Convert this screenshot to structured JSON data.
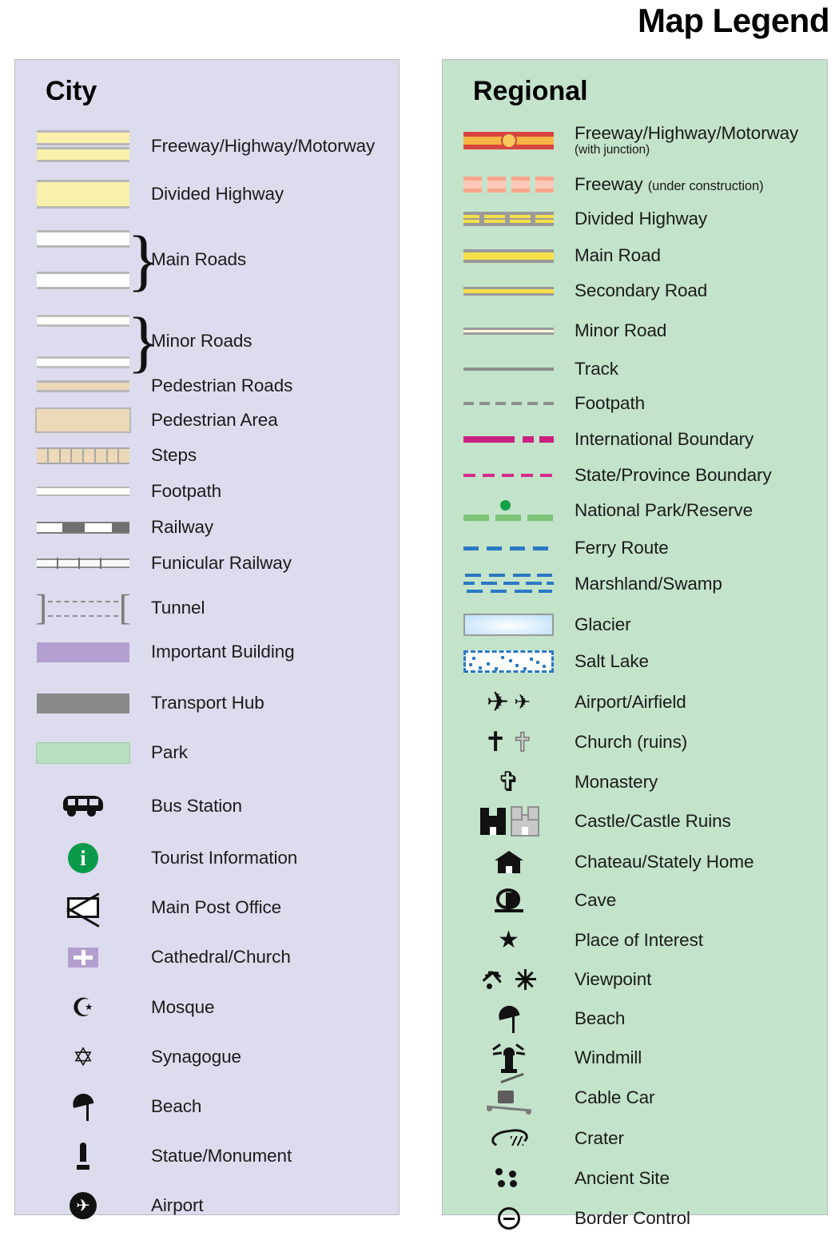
{
  "title": "Map Legend",
  "panels": {
    "city": {
      "heading": "City",
      "items": [
        {
          "label": "Freeway/Highway/Motorway",
          "symbol": "freeway-double-band"
        },
        {
          "label": "Divided Highway",
          "symbol": "divided-highway-band"
        },
        {
          "label": "Main Roads",
          "symbol": "main-roads-brace"
        },
        {
          "label": "Minor Roads",
          "symbol": "minor-roads-brace"
        },
        {
          "label": "Pedestrian Roads",
          "symbol": "pedestrian-road-band"
        },
        {
          "label": "Pedestrian Area",
          "symbol": "pedestrian-area-block"
        },
        {
          "label": "Steps",
          "symbol": "steps-band"
        },
        {
          "label": "Footpath",
          "symbol": "footpath-line"
        },
        {
          "label": "Railway",
          "symbol": "railway-dashed-line"
        },
        {
          "label": "Funicular Railway",
          "symbol": "funicular-tick-line"
        },
        {
          "label": "Tunnel",
          "symbol": "tunnel-bracket"
        },
        {
          "label": "Important Building",
          "symbol": "important-building-swatch"
        },
        {
          "label": "Transport Hub",
          "symbol": "transport-hub-swatch"
        },
        {
          "label": "Park",
          "symbol": "park-swatch"
        },
        {
          "label": "Bus Station",
          "symbol": "bus-icon"
        },
        {
          "label": "Tourist Information",
          "symbol": "information-icon"
        },
        {
          "label": "Main Post Office",
          "symbol": "envelope-icon"
        },
        {
          "label": "Cathedral/Church",
          "symbol": "cathedral-icon"
        },
        {
          "label": "Mosque",
          "symbol": "star-and-crescent-icon"
        },
        {
          "label": "Synagogue",
          "symbol": "star-of-david-icon"
        },
        {
          "label": "Beach",
          "symbol": "beach-umbrella-icon"
        },
        {
          "label": "Statue/Monument",
          "symbol": "statue-icon"
        },
        {
          "label": "Airport",
          "symbol": "airport-circle-icon"
        }
      ]
    },
    "regional": {
      "heading": "Regional",
      "items": [
        {
          "label": "Freeway/Highway/Motorway",
          "sublabel": "(with junction)",
          "sub_position": "below",
          "symbol": "freeway-junction-line"
        },
        {
          "label": "Freeway",
          "sublabel": "(under construction)",
          "sub_position": "inline",
          "symbol": "freeway-dashed-line"
        },
        {
          "label": "Divided Highway",
          "symbol": "divided-highway-line"
        },
        {
          "label": "Main Road",
          "symbol": "main-road-line"
        },
        {
          "label": "Secondary Road",
          "symbol": "secondary-road-line"
        },
        {
          "label": "Minor Road",
          "symbol": "minor-road-line"
        },
        {
          "label": "Track",
          "symbol": "track-line"
        },
        {
          "label": "Footpath",
          "symbol": "footpath-dashed-line"
        },
        {
          "label": "International Boundary",
          "symbol": "international-boundary-line"
        },
        {
          "label": "State/Province Boundary",
          "symbol": "state-boundary-line"
        },
        {
          "label": "National Park/Reserve",
          "symbol": "national-park-line"
        },
        {
          "label": "Ferry Route",
          "symbol": "ferry-route-line"
        },
        {
          "label": "Marshland/Swamp",
          "symbol": "marshland-pattern"
        },
        {
          "label": "Glacier",
          "symbol": "glacier-swatch"
        },
        {
          "label": "Salt Lake",
          "symbol": "salt-lake-swatch"
        },
        {
          "label": "Airport/Airfield",
          "symbol": "airplane-icon"
        },
        {
          "label": "Church (ruins)",
          "symbol": "church-cross-icon"
        },
        {
          "label": "Monastery",
          "symbol": "monastery-cross-icon"
        },
        {
          "label": "Castle/Castle Ruins",
          "symbol": "castle-icon"
        },
        {
          "label": "Chateau/Stately Home",
          "symbol": "chateau-icon"
        },
        {
          "label": "Cave",
          "symbol": "cave-icon"
        },
        {
          "label": "Place of Interest",
          "symbol": "star-icon"
        },
        {
          "label": "Viewpoint",
          "symbol": "viewpoint-icon"
        },
        {
          "label": "Beach",
          "symbol": "beach-umbrella-icon"
        },
        {
          "label": "Windmill",
          "symbol": "windmill-icon"
        },
        {
          "label": "Cable Car",
          "symbol": "cable-car-icon"
        },
        {
          "label": "Crater",
          "symbol": "crater-icon"
        },
        {
          "label": "Ancient Site",
          "symbol": "ancient-site-icon"
        },
        {
          "label": "Border Control",
          "symbol": "border-control-icon"
        }
      ]
    }
  },
  "colors": {
    "city_panel_bg": "#dddcee",
    "regional_panel_bg": "#c3e3ca",
    "highway_yellow": "#f8f0ab",
    "road_yellow": "#f6e04a",
    "freeway_red": "#d8443f",
    "freeway_orange": "#f6b545",
    "pedestrian_tan": "#ecd9b8",
    "important_building_purple": "#b39fcf",
    "transport_hub_gray": "#8a8a8a",
    "park_green": "#b7dfc0",
    "boundary_magenta": "#cc2080",
    "national_park_green": "#7ec478",
    "ferry_blue": "#2b78c4",
    "glacier_blue": "#cfe8fa",
    "information_green": "#0a9a4a"
  }
}
